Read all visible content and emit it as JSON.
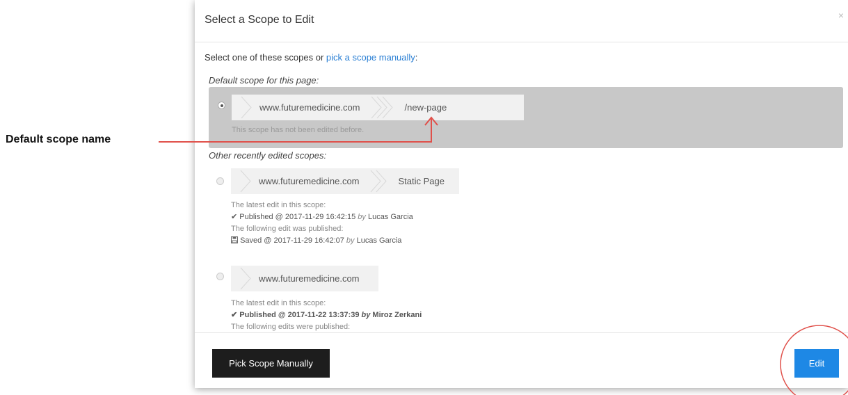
{
  "annotation": {
    "label": "Default scope name",
    "line_color": "#e0504a"
  },
  "modal": {
    "title": "Select a Scope to Edit",
    "close_icon": "×",
    "intro_prefix": "Select one of these scopes or ",
    "intro_link": "pick a scope manually",
    "intro_suffix": ":",
    "default_section": {
      "title": "Default scope for this page:",
      "breadcrumb": [
        "www.futuremedicine.com",
        "/new-page"
      ],
      "note": "This scope has not been edited before."
    },
    "other_section": {
      "title": "Other recently edited scopes:",
      "items": [
        {
          "breadcrumb": [
            "www.futuremedicine.com",
            "Static Page"
          ],
          "line1": "The latest edit in this scope:",
          "status_icon": "✔",
          "status": "Published @ 2017-11-29 16:42:15",
          "by": "by",
          "user": "Lucas Garcia",
          "line3": "The following edit was published:",
          "saved_icon": "💾",
          "saved": "Saved @ 2017-11-29 16:42:07",
          "saved_by": "by",
          "saved_user": "Lucas Garcia"
        },
        {
          "breadcrumb": [
            "www.futuremedicine.com"
          ],
          "line1": "The latest edit in this scope:",
          "status_icon": "✔",
          "status": "Published @ 2017-11-22 13:37:39",
          "by": "by",
          "user": "Miroz Zerkani",
          "line3": "The following edits were published:"
        }
      ]
    },
    "footer": {
      "pick_button": "Pick Scope Manually",
      "edit_button": "Edit"
    }
  },
  "colors": {
    "primary": "#1e88e5",
    "dark_button": "#1d1d1d",
    "link": "#2a7fd4",
    "selected_bg": "#c8c8c8",
    "annotation": "#e0504a"
  }
}
